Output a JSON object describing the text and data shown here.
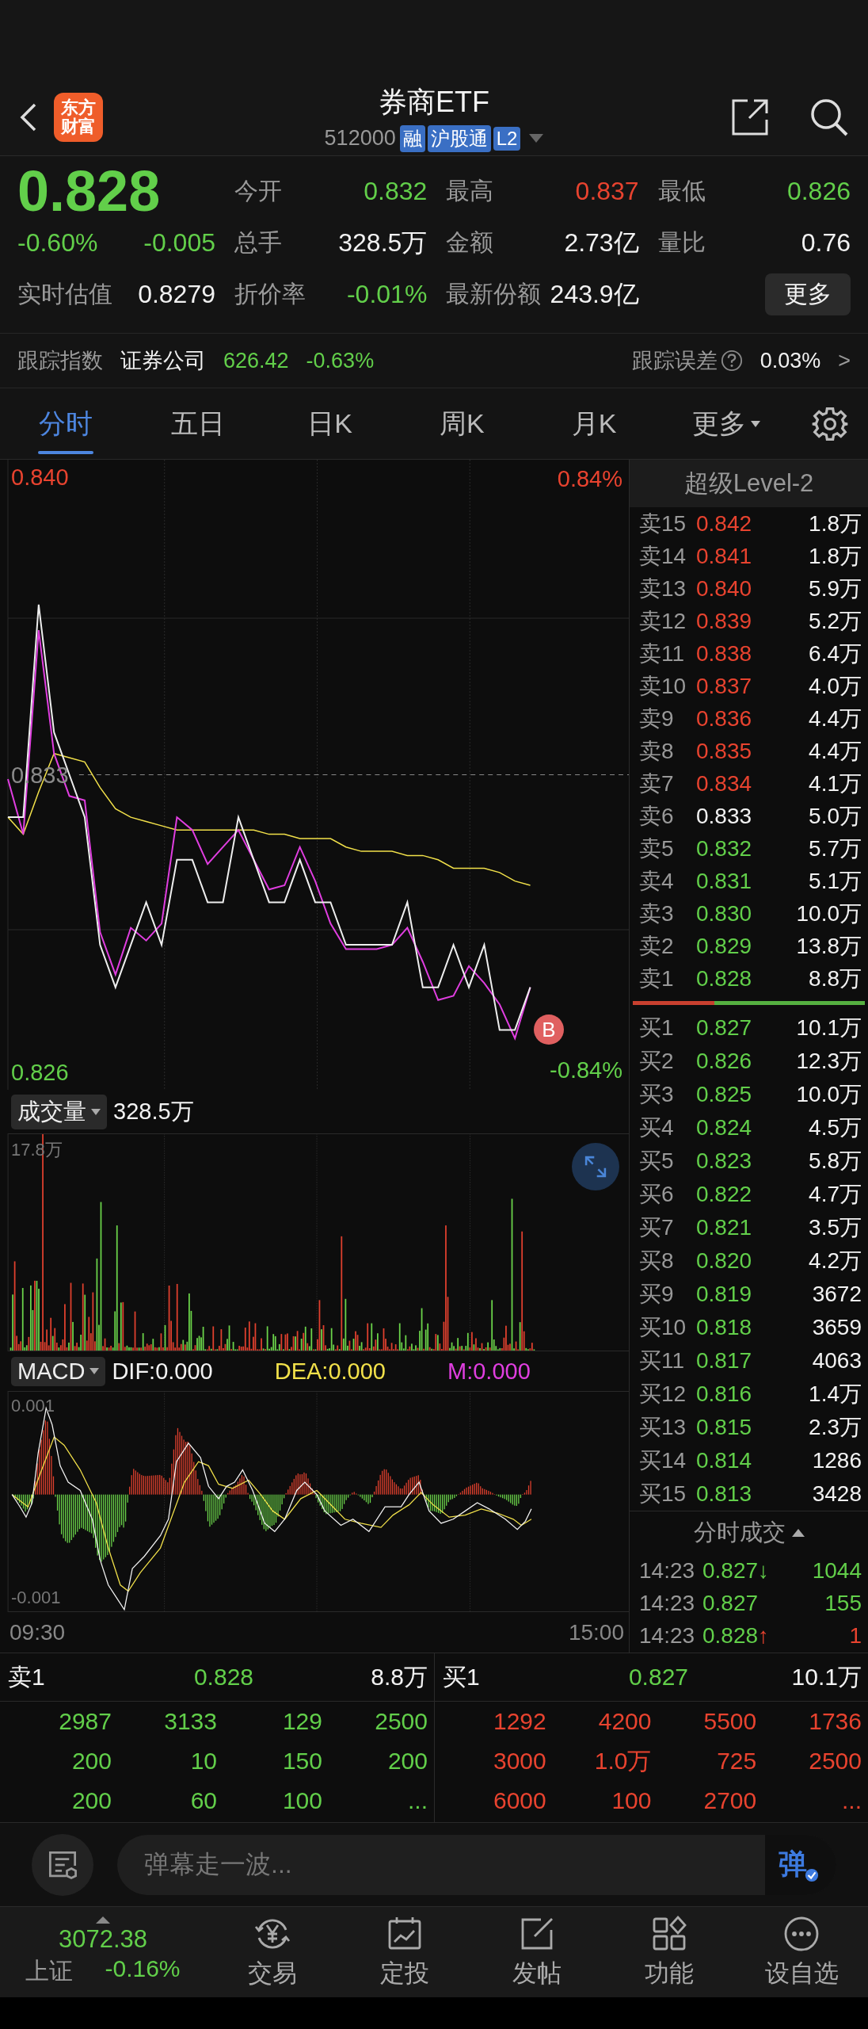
{
  "header": {
    "title": "券商ETF",
    "code": "512000",
    "tags": [
      "融",
      "沪股通",
      "L2"
    ],
    "logo": "东方财富"
  },
  "quote": {
    "price": "0.828",
    "change_pct": "-0.60%",
    "change": "-0.005",
    "color": "#62cf4a",
    "estimate": {
      "label": "实时估值",
      "value": "0.8279"
    },
    "fields": [
      {
        "label": "今开",
        "value": "0.832",
        "color": "#62cf4a"
      },
      {
        "label": "最高",
        "value": "0.837",
        "color": "#e8432f"
      },
      {
        "label": "最低",
        "value": "0.826",
        "color": "#62cf4a"
      },
      {
        "label": "总手",
        "value": "328.5万",
        "color": "#f2f2f2"
      },
      {
        "label": "金额",
        "value": "2.73亿",
        "color": "#f2f2f2"
      },
      {
        "label": "量比",
        "value": "0.76",
        "color": "#f2f2f2"
      },
      {
        "label": "折价率",
        "value": "-0.01%",
        "color": "#62cf4a"
      },
      {
        "label": "最新份额",
        "value": "243.9亿",
        "color": "#f2f2f2"
      }
    ],
    "more_button": "更多"
  },
  "tracking": {
    "label": "跟踪指数",
    "index_name": "证券公司",
    "value": "626.42",
    "change": "-0.63%",
    "color": "#62cf4a",
    "error_label": "跟踪误差",
    "error_value": "0.03%",
    "chevron": ">"
  },
  "tabs": [
    {
      "label": "分时",
      "selected": true,
      "kind": "tab"
    },
    {
      "label": "五日",
      "selected": false,
      "kind": "tab"
    },
    {
      "label": "日K",
      "selected": false,
      "kind": "tab"
    },
    {
      "label": "周K",
      "selected": false,
      "kind": "tab"
    },
    {
      "label": "月K",
      "selected": false,
      "kind": "tab"
    },
    {
      "label": "更多",
      "selected": false,
      "kind": "menu"
    }
  ],
  "price_chart": {
    "pct_max": "0.84%",
    "pct_min": "-0.84%",
    "marker": "B",
    "chart_data": {
      "type": "line",
      "ylim": [
        0.82559,
        0.84041
      ],
      "yticks": [
        {
          "value": 0.84,
          "label": "0.840"
        },
        {
          "value": 0.833,
          "label": "0.833"
        },
        {
          "value": 0.826,
          "label": "0.826"
        }
      ],
      "categories": [
        null,
        null,
        null,
        null,
        null,
        null,
        null,
        null,
        null,
        null,
        null,
        null,
        null,
        null,
        null,
        null,
        null,
        null,
        null,
        null,
        null,
        null,
        null,
        null,
        null,
        null,
        null,
        null,
        null,
        null,
        null,
        null,
        null,
        null,
        null,
        null,
        null,
        null,
        null,
        null,
        null
      ],
      "series": [
        {
          "color": "#f2e14a",
          "values": [
            0.832,
            0.8316,
            0.8326,
            0.8335,
            0.8334,
            0.8333,
            0.8327,
            0.8322,
            0.832,
            0.8319,
            0.8318,
            0.8317,
            0.8317,
            0.8317,
            0.8317,
            0.8317,
            0.8317,
            0.8316,
            0.8316,
            0.8315,
            0.8315,
            0.8315,
            0.8313,
            0.8312,
            0.8312,
            0.8312,
            0.8311,
            0.8311,
            0.831,
            0.8308,
            0.8308,
            0.8308,
            0.8307,
            0.8305,
            0.8304,
            null,
            null,
            null,
            null,
            null,
            null
          ]
        },
        {
          "color": "#e03ee0",
          "values": [
            0.8329,
            0.8316,
            0.8364,
            0.8335,
            0.8325,
            0.8324,
            0.8293,
            0.8283,
            0.8294,
            0.8291,
            0.8295,
            0.832,
            0.8317,
            0.8309,
            0.8313,
            0.8317,
            0.831,
            0.8303,
            0.8304,
            0.8313,
            0.8305,
            0.8295,
            0.8289,
            0.8289,
            0.8289,
            0.829,
            0.8294,
            0.8286,
            0.8277,
            0.8278,
            0.8285,
            0.8281,
            0.8276,
            0.8268,
            0.828,
            null,
            null,
            null,
            null,
            null,
            null
          ]
        },
        {
          "color": "#eeeeee",
          "values": [
            0.832,
            0.832,
            0.837,
            0.834,
            0.833,
            0.832,
            0.829,
            0.828,
            0.829,
            0.83,
            0.829,
            0.831,
            0.831,
            0.83,
            0.83,
            0.832,
            0.831,
            0.83,
            0.83,
            0.831,
            0.83,
            0.83,
            0.829,
            0.829,
            0.829,
            0.829,
            0.83,
            0.828,
            0.828,
            0.829,
            0.828,
            0.829,
            0.827,
            0.827,
            0.828,
            null,
            null,
            null,
            null,
            null,
            null
          ]
        }
      ]
    }
  },
  "volume_panel": {
    "selector": "成交量",
    "total": "328.5万",
    "y_max": "17.8万"
  },
  "macd_panel": {
    "selector": "MACD",
    "dif": "DIF:0.000",
    "dea": "DEA:0.000",
    "m": "M:0.000",
    "y_max": "0.001",
    "y_min": "-0.001"
  },
  "time_axis": {
    "start": "09:30",
    "end": "15:00"
  },
  "order_book": {
    "title": "超级Level-2",
    "asks": [
      {
        "label": "卖15",
        "price": "0.842",
        "volume": "1.8万",
        "color": "#e8432f"
      },
      {
        "label": "卖14",
        "price": "0.841",
        "volume": "1.8万",
        "color": "#e8432f"
      },
      {
        "label": "卖13",
        "price": "0.840",
        "volume": "5.9万",
        "color": "#e8432f"
      },
      {
        "label": "卖12",
        "price": "0.839",
        "volume": "5.2万",
        "color": "#e8432f"
      },
      {
        "label": "卖11",
        "price": "0.838",
        "volume": "6.4万",
        "color": "#e8432f"
      },
      {
        "label": "卖10",
        "price": "0.837",
        "volume": "4.0万",
        "color": "#e8432f"
      },
      {
        "label": "卖9",
        "price": "0.836",
        "volume": "4.4万",
        "color": "#e8432f"
      },
      {
        "label": "卖8",
        "price": "0.835",
        "volume": "4.4万",
        "color": "#e8432f"
      },
      {
        "label": "卖7",
        "price": "0.834",
        "volume": "4.1万",
        "color": "#e8432f"
      },
      {
        "label": "卖6",
        "price": "0.833",
        "volume": "5.0万",
        "color": "#f2f2f2"
      },
      {
        "label": "卖5",
        "price": "0.832",
        "volume": "5.7万",
        "color": "#62cf4a"
      },
      {
        "label": "卖4",
        "price": "0.831",
        "volume": "5.1万",
        "color": "#62cf4a"
      },
      {
        "label": "卖3",
        "price": "0.830",
        "volume": "10.0万",
        "color": "#62cf4a"
      },
      {
        "label": "卖2",
        "price": "0.829",
        "volume": "13.8万",
        "color": "#62cf4a"
      },
      {
        "label": "卖1",
        "price": "0.828",
        "volume": "8.8万",
        "color": "#62cf4a"
      }
    ],
    "ratio_bar": {
      "level": 0.35
    },
    "bids": [
      {
        "label": "买1",
        "price": "0.827",
        "volume": "10.1万",
        "color": "#62cf4a"
      },
      {
        "label": "买2",
        "price": "0.826",
        "volume": "12.3万",
        "color": "#62cf4a"
      },
      {
        "label": "买3",
        "price": "0.825",
        "volume": "10.0万",
        "color": "#62cf4a"
      },
      {
        "label": "买4",
        "price": "0.824",
        "volume": "4.5万",
        "color": "#62cf4a"
      },
      {
        "label": "买5",
        "price": "0.823",
        "volume": "5.8万",
        "color": "#62cf4a"
      },
      {
        "label": "买6",
        "price": "0.822",
        "volume": "4.7万",
        "color": "#62cf4a"
      },
      {
        "label": "买7",
        "price": "0.821",
        "volume": "3.5万",
        "color": "#62cf4a"
      },
      {
        "label": "买8",
        "price": "0.820",
        "volume": "4.2万",
        "color": "#62cf4a"
      },
      {
        "label": "买9",
        "price": "0.819",
        "volume": "3672",
        "color": "#62cf4a"
      },
      {
        "label": "买10",
        "price": "0.818",
        "volume": "3659",
        "color": "#62cf4a"
      },
      {
        "label": "买11",
        "price": "0.817",
        "volume": "4063",
        "color": "#62cf4a"
      },
      {
        "label": "买12",
        "price": "0.816",
        "volume": "1.4万",
        "color": "#62cf4a"
      },
      {
        "label": "买13",
        "price": "0.815",
        "volume": "2.3万",
        "color": "#62cf4a"
      },
      {
        "label": "买14",
        "price": "0.814",
        "volume": "1286",
        "color": "#62cf4a"
      },
      {
        "label": "买15",
        "price": "0.813",
        "volume": "3428",
        "color": "#62cf4a"
      }
    ]
  },
  "trades": {
    "title": "分时成交",
    "rows": [
      {
        "time": "14:23",
        "price": "0.827",
        "color": "#62cf4a",
        "arrow": "↓",
        "volume": {
          "value": "1044",
          "color": "#62cf4a"
        }
      },
      {
        "time": "14:23",
        "price": "0.827",
        "color": "#62cf4a",
        "volume": {
          "value": "155",
          "color": "#62cf4a"
        }
      },
      {
        "time": "14:23",
        "price": "0.828",
        "color": "#62cf4a",
        "arrow": "↑",
        "volume": {
          "value": "1",
          "color": "#e8432f"
        }
      }
    ]
  },
  "tick_table": {
    "sides": [
      {
        "label": "卖1",
        "price": {
          "value": "0.828",
          "color": "#62cf4a"
        },
        "volume": "8.8万",
        "color": "#62cf4a",
        "rows": [
          [
            "2987",
            "3133",
            "129",
            "2500"
          ],
          [
            "200",
            "10",
            "150",
            "200"
          ],
          [
            "200",
            "60",
            "100",
            "..."
          ]
        ]
      },
      {
        "label": "买1",
        "price": {
          "value": "0.827",
          "color": "#62cf4a"
        },
        "volume": "10.1万",
        "color": "#e8432f",
        "rows": [
          [
            "1292",
            "4200",
            "5500",
            "1736"
          ],
          [
            "3000",
            "1.0万",
            "725",
            "2500"
          ],
          [
            "6000",
            "100",
            "2700",
            "..."
          ]
        ]
      }
    ]
  },
  "comment_bar": {
    "placeholder": "弹幕走一波...",
    "send": "弹"
  },
  "bottom_nav": {
    "index": {
      "value": "3072.38",
      "name": "上证",
      "change": "-0.16%",
      "color": "#62cf4a"
    },
    "items": [
      {
        "kind": "trade",
        "label": "交易"
      },
      {
        "kind": "plan",
        "label": "定投"
      },
      {
        "kind": "post",
        "label": "发帖"
      },
      {
        "kind": "apps",
        "label": "功能"
      },
      {
        "kind": "more",
        "label": "设自选"
      }
    ]
  }
}
